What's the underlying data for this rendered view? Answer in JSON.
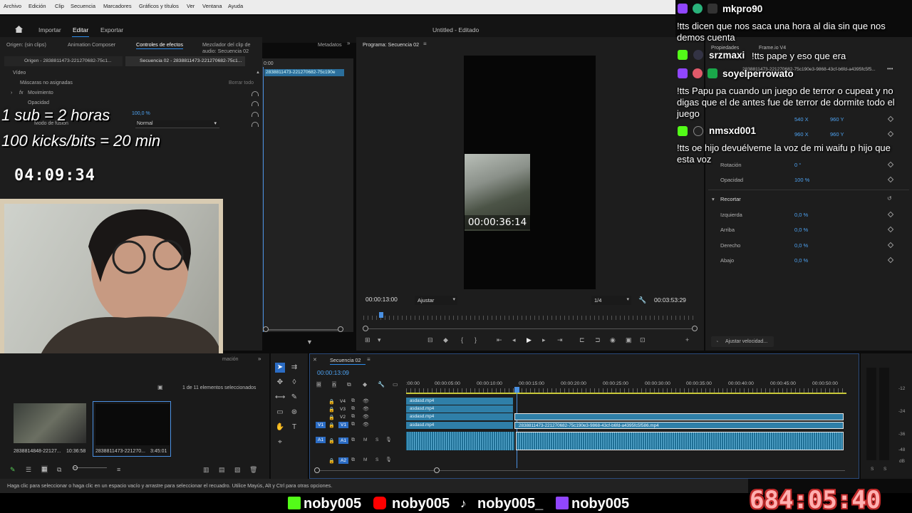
{
  "menubar": {
    "items": [
      "Archivo",
      "Edición",
      "Clip",
      "Secuencia",
      "Marcadores",
      "Gráficos y títulos",
      "Ver",
      "Ventana",
      "Ayuda"
    ]
  },
  "workspace": {
    "home_icon": "home-icon",
    "tabs": [
      "Importar",
      "Editar",
      "Exportar"
    ],
    "active_tab": "Editar",
    "project_title": "Untitled - Editado"
  },
  "effect_controls": {
    "tabs": [
      "Origen: (sin clips)",
      "Animation Composer",
      "Controles de efectos",
      "Mezclador del clip de audio: Secuencia 02",
      "Metadatos"
    ],
    "source_dropdown": "Origen - 2838811473-221270682-75c1...",
    "sequence_dropdown": "Secuencia 02 - 2838811473-221270682-75c1...",
    "section_video": "Vídeo",
    "masks_label": "Máscaras no asignadas",
    "clear_all": "Borrar todo",
    "movimiento": "Movimiento",
    "opacidad": "Opacidad",
    "opacity_value": "100,0 %",
    "blend_label": "Modo de fusión",
    "blend_value": "Normal",
    "mini_timecode": "0:00",
    "mini_clip": "2838811473-221270682-75c190e"
  },
  "program": {
    "title": "Programa: Secuencia 02",
    "current_tc": "00:00:13:00",
    "fit": "Ajustar",
    "resolution": "1/4",
    "duration_tc": "00:03:53:29",
    "frame_tc": "00:00:36:14"
  },
  "right_panel": {
    "tabs": [
      "Propiedades",
      "Frame.io V4"
    ],
    "clip_name": "2838811473-221270682-75c190e3-9868-43cf-b6fd-a4395fc5f5...",
    "positions": [
      {
        "x": "540 X",
        "y": "960 Y"
      },
      {
        "x": "960 X",
        "y": "960 Y"
      }
    ],
    "props": [
      {
        "label": "Rotación",
        "value": "0 °"
      },
      {
        "label": "Opacidad",
        "value": "100 %"
      }
    ],
    "recortar": "Recortar",
    "crop": [
      {
        "label": "Izquierda",
        "value": "0,0 %"
      },
      {
        "label": "Arriba",
        "value": "0,0 %"
      },
      {
        "label": "Derecho",
        "value": "0,0 %"
      },
      {
        "label": "Abajo",
        "value": "0,0 %"
      }
    ],
    "speed_button": "Ajustar velocidad..."
  },
  "chat": [
    {
      "user": "mkpro90",
      "message": "!tts dicen que nos saca una hora al dia sin que nos demos cuenta"
    },
    {
      "user": "srzmaxi",
      "message": "!tts pape y eso que era"
    },
    {
      "user": "soyelperrowato",
      "message": "!tts Papu pa cuando un juego de terror o cupeat y no digas que el de antes fue de terror de dormite todo el juego"
    },
    {
      "user": "nmsxd001",
      "message": "!tts oe hijo devuélveme la voz de mi waifu p hijo que esta voz"
    }
  ],
  "overlay": {
    "sub_line": "1 sub = 2 horas",
    "kicks_line": "100 kicks/bits = 20 min",
    "timer": "04:09:34",
    "big_timer": "684:05:40"
  },
  "project": {
    "selected_count": "1 de 11 elementos seleccionados",
    "items": [
      {
        "name": "2838814848-22127...",
        "duration": "10:36:58"
      },
      {
        "name": "2838811473-221270...",
        "duration": "3:45:01"
      }
    ],
    "partial_tab": "mación"
  },
  "timeline": {
    "sequence_tab": "Secuencia 02",
    "timecode": "00:00:13:09",
    "ruler": [
      ":00:00",
      "00:00:05:00",
      "00:00:10:00",
      "00:00:15:00",
      "00:00:20:00",
      "00:00:25:00",
      "00:00:30:00",
      "00:00:35:00",
      "00:00:40:00",
      "00:00:45:00",
      "00:00:50:00"
    ],
    "video_tracks": [
      "V4",
      "V3",
      "V2",
      "V1"
    ],
    "audio_tracks": [
      "A1",
      "A2"
    ],
    "clip_name": "asdasd.mp4",
    "long_clip": "2838811473-221270682-75c190e3-9868-43cf-b6fd-a4395fc5f586.mp4"
  },
  "meters": {
    "labels": [
      "-12",
      "-24",
      "-36",
      "-48",
      "dB"
    ],
    "solo": [
      "S",
      "S"
    ]
  },
  "status": {
    "hint": "Haga clic para seleccionar o haga clic en un espacio vacío y arrastre para seleccionar el recuadro. Utilice Mayús, Alt y Ctrl para otras opciones."
  },
  "socials": [
    {
      "platform": "kick",
      "handle": "noby005",
      "color": "#53fc18"
    },
    {
      "platform": "youtube",
      "handle": "noby005",
      "color": "#ff0000"
    },
    {
      "platform": "tiktok",
      "handle": "noby005_",
      "color": "#ffffff"
    },
    {
      "platform": "twitch",
      "handle": "noby005",
      "color": "#9146ff"
    }
  ]
}
